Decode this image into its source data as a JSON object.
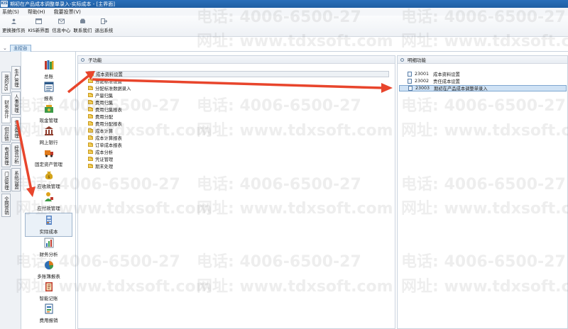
{
  "window": {
    "logo": "KIS",
    "title": "期初在产品成本调整单录入-实际成本 - [主界面]"
  },
  "menubar": {
    "items": [
      "系统(S)",
      "帮助(H)",
      "我要投票(V)"
    ]
  },
  "toolbar": {
    "buttons": [
      {
        "label": "更换操作员",
        "icon": "user-icon"
      },
      {
        "label": "KIS新界面",
        "icon": "window-icon"
      },
      {
        "label": "信息中心",
        "icon": "mail-icon"
      },
      {
        "label": "联系我们",
        "icon": "phone-icon"
      },
      {
        "label": "退出系统",
        "icon": "exit-icon"
      }
    ]
  },
  "nav": {
    "tab_label": "主控台"
  },
  "vertical_tabs": {
    "outer": [
      "我的KIS",
      "财务会计",
      "供应链",
      "电商管理",
      "门店管理",
      "全网营销"
    ],
    "inner": [
      "生产管理",
      "人事管理",
      "资金管理",
      "经营分析",
      "系统设置"
    ],
    "active_outer": "财务会计",
    "active_inner": "资金管理"
  },
  "modules": {
    "items": [
      "总账",
      "报表",
      "现金管理",
      "网上银行",
      "固定资产管理",
      "应收款管理",
      "应付款管理",
      "实际成本",
      "财务分析",
      "多账簿报表",
      "智能记账",
      "费用报销"
    ],
    "selected": "实际成本"
  },
  "sub_functions": {
    "header": "子功能",
    "items": [
      "成本资料设置",
      "分配标准设置",
      "分配标准数据录入",
      "产量归集",
      "费用归集",
      "费用归集报表",
      "费用分配",
      "费用分配报表",
      "成本计算",
      "成本计算报表",
      "订单成本报表",
      "成本分析",
      "凭证管理",
      "期末处理"
    ],
    "selected": "成本资料设置"
  },
  "detail_functions": {
    "header": "明细功能",
    "items": [
      {
        "code": "23001",
        "name": "成本资料设置"
      },
      {
        "code": "23002",
        "name": "责任成本设置"
      },
      {
        "code": "23003",
        "name": "期初在产品成本调整单录入"
      }
    ],
    "selected": "23003"
  },
  "watermark": {
    "phone": "电话: 4006-6500-27",
    "site": "网址: www.tdxsoft.com"
  },
  "colors": {
    "title_bar": "#1f5ea3",
    "arrow": "#e8452c",
    "selection": "#cfe2f5",
    "folder": "#f3cf5a"
  }
}
